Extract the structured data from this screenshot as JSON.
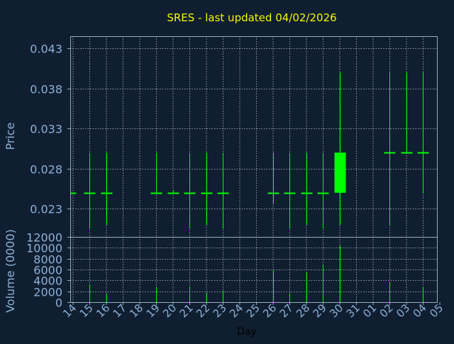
{
  "colors": {
    "background": "#0f1f31",
    "plot_border": "#9aa9bd",
    "grid": "#ffffff",
    "axis_text": "#8fb0d6",
    "title": "#f5f500",
    "xlabel": "#000000",
    "candle": "#00ff00"
  },
  "chart_data": [
    {
      "type": "candlestick",
      "title": "SRES - last updated 04/02/2026",
      "ylabel": "Price",
      "ylim": [
        0.0195,
        0.0445
      ],
      "yticks": [
        "0.043",
        "0.038",
        "0.033",
        "0.028",
        "0.023"
      ],
      "yticks_values": [
        0.043,
        0.038,
        0.033,
        0.028,
        0.023
      ],
      "grid": true,
      "days": [
        "14",
        "15",
        "16",
        "17",
        "18",
        "19",
        "20",
        "21",
        "22",
        "23",
        "24",
        "25",
        "26",
        "27",
        "28",
        "29",
        "30",
        "31",
        "01",
        "02",
        "03",
        "04",
        "05"
      ],
      "candles": [
        {
          "day": "14",
          "open": 0.025,
          "high": 0.025,
          "low": 0.025,
          "close": 0.025
        },
        {
          "day": "15",
          "open": 0.025,
          "high": 0.03,
          "low": 0.0205,
          "close": 0.025
        },
        {
          "day": "16",
          "open": 0.025,
          "high": 0.03,
          "low": 0.021,
          "close": 0.025
        },
        {
          "day": "19",
          "open": 0.025,
          "high": 0.03,
          "low": 0.025,
          "close": 0.025
        },
        {
          "day": "20",
          "open": 0.025,
          "high": 0.0253,
          "low": 0.025,
          "close": 0.025
        },
        {
          "day": "21",
          "open": 0.025,
          "high": 0.03,
          "low": 0.0205,
          "close": 0.025
        },
        {
          "day": "22",
          "open": 0.025,
          "high": 0.03,
          "low": 0.021,
          "close": 0.025
        },
        {
          "day": "23",
          "open": 0.025,
          "high": 0.03,
          "low": 0.0205,
          "close": 0.025
        },
        {
          "day": "26",
          "open": 0.025,
          "high": 0.03,
          "low": 0.0236,
          "close": 0.025
        },
        {
          "day": "27",
          "open": 0.025,
          "high": 0.03,
          "low": 0.0205,
          "close": 0.025
        },
        {
          "day": "28",
          "open": 0.025,
          "high": 0.03,
          "low": 0.021,
          "close": 0.025
        },
        {
          "day": "29",
          "open": 0.025,
          "high": 0.03,
          "low": 0.0205,
          "close": 0.025
        },
        {
          "day": "30",
          "open": 0.025,
          "high": 0.04,
          "low": 0.021,
          "close": 0.03
        },
        {
          "day": "02",
          "open": 0.03,
          "high": 0.04,
          "low": 0.021,
          "close": 0.03
        },
        {
          "day": "03",
          "open": 0.03,
          "high": 0.04,
          "low": 0.03,
          "close": 0.03
        },
        {
          "day": "04",
          "open": 0.03,
          "high": 0.04,
          "low": 0.025,
          "close": 0.03
        }
      ]
    },
    {
      "type": "bar",
      "ylabel": "Volume (0000)",
      "xlabel": "Day",
      "ylim": [
        0,
        12000
      ],
      "yticks": [
        "12000",
        "10000",
        "8000",
        "6000",
        "4000",
        "2000",
        "0"
      ],
      "yticks_values": [
        12000,
        10000,
        8000,
        6000,
        4000,
        2000,
        0
      ],
      "grid": true,
      "categories": [
        "15",
        "16",
        "19",
        "21",
        "22",
        "23",
        "26",
        "27",
        "28",
        "29",
        "30",
        "02",
        "04"
      ],
      "values": [
        3200,
        1600,
        2800,
        2800,
        1700,
        2100,
        5800,
        1600,
        5500,
        6800,
        10400,
        3700,
        2800
      ]
    }
  ]
}
